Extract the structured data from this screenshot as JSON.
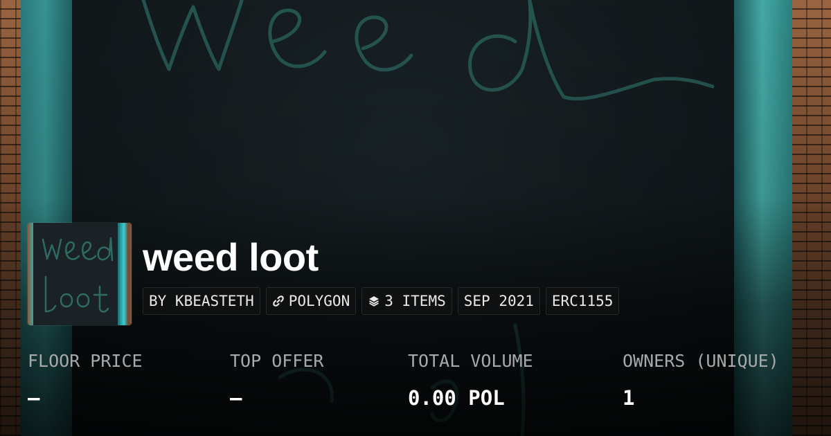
{
  "collection": {
    "title": "weed loot",
    "tags": [
      {
        "label": "BY KBEASTETH",
        "icon": ""
      },
      {
        "label": "POLYGON",
        "icon": "chain-link-icon"
      },
      {
        "label": "3 ITEMS",
        "icon": "layers-icon"
      },
      {
        "label": "SEP 2021",
        "icon": ""
      },
      {
        "label": "ERC1155",
        "icon": ""
      }
    ]
  },
  "stats": [
    {
      "label": "FLOOR PRICE",
      "value": "—"
    },
    {
      "label": "TOP OFFER",
      "value": "—"
    },
    {
      "label": "TOTAL VOLUME",
      "value": "0.00 POL"
    },
    {
      "label": "OWNERS (UNIQUE)",
      "value": "1"
    }
  ],
  "colors": {
    "background": "#0b0e10",
    "frame_teal": "#3a9a9a",
    "scribble": "#2e6e66",
    "text_primary": "#ffffff",
    "text_muted": "#a7a9ab"
  }
}
